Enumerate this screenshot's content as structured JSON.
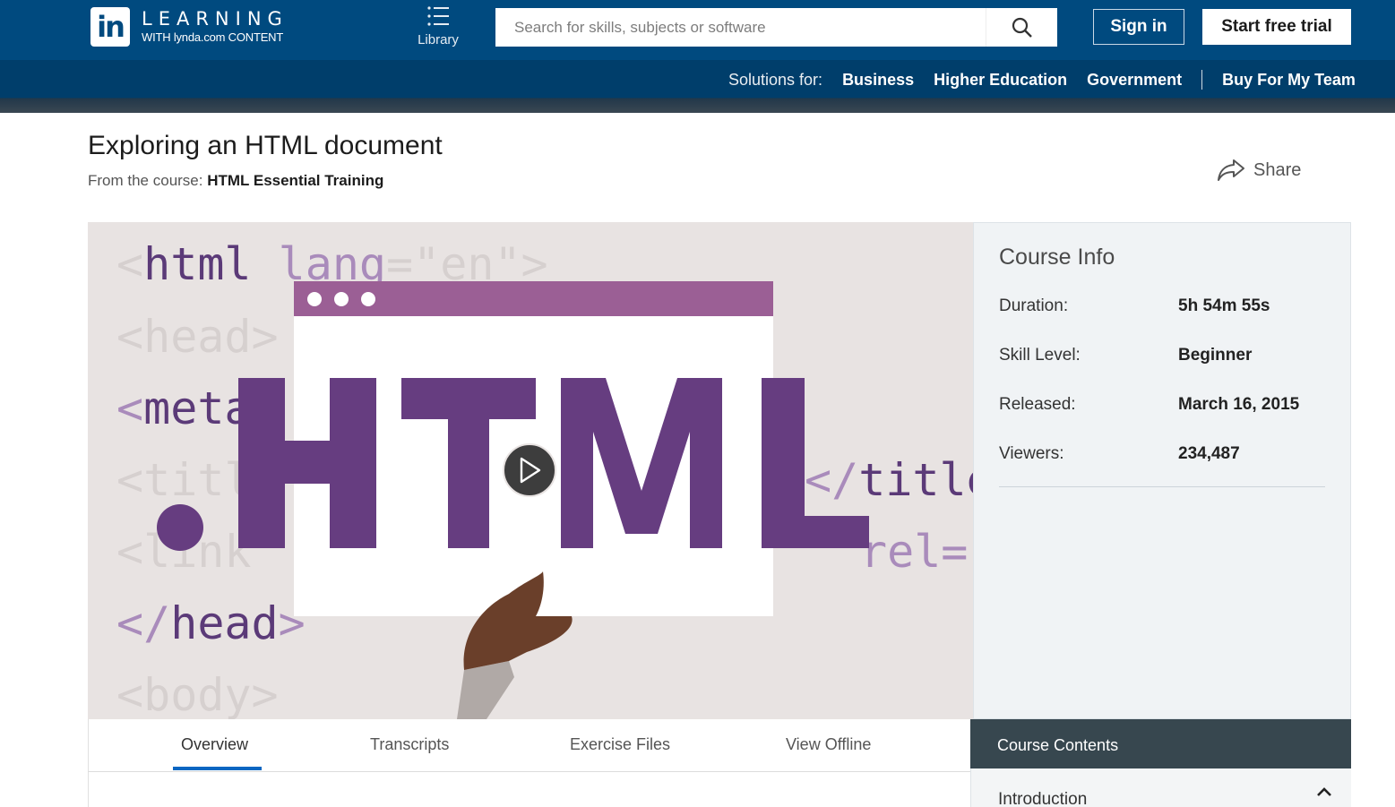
{
  "header": {
    "logo_in": "in",
    "logo_learning": "LEARNING",
    "logo_sub": "WITH lynda.com CONTENT",
    "library_label": "Library",
    "search_placeholder": "Search for skills, subjects or software",
    "sign_in_label": "Sign in",
    "start_trial_label": "Start free trial"
  },
  "subnav": {
    "label": "Solutions for:",
    "links": [
      "Business",
      "Higher Education",
      "Government",
      "Buy For My Team"
    ]
  },
  "page": {
    "title": "Exploring an HTML document",
    "from_prefix": "From the course:",
    "course_name": "HTML Essential Training",
    "share_label": "Share"
  },
  "video": {
    "code_lines": [
      "<html lang=\"en\">",
      "<head>",
      "<meta",
      "<titl",
      "<link",
      "</head>",
      "<body>"
    ],
    "code_right": [
      "</title",
      "rel='"
    ],
    "big_text": ".HTML"
  },
  "course_info": {
    "title": "Course Info",
    "rows": [
      {
        "key": "Duration:",
        "value": "5h 54m 55s"
      },
      {
        "key": "Skill Level:",
        "value": "Beginner"
      },
      {
        "key": "Released:",
        "value": "March 16, 2015"
      },
      {
        "key": "Viewers:",
        "value": "234,487"
      }
    ]
  },
  "tabs": [
    "Overview",
    "Transcripts",
    "Exercise Files",
    "View Offline"
  ],
  "course_contents": {
    "header": "Course Contents",
    "section": "Introduction"
  },
  "colors": {
    "header_blue": "#004a7f",
    "accent_purple": "#663d80",
    "tab_underline": "#0a66c2",
    "contents_header": "#37474f"
  }
}
